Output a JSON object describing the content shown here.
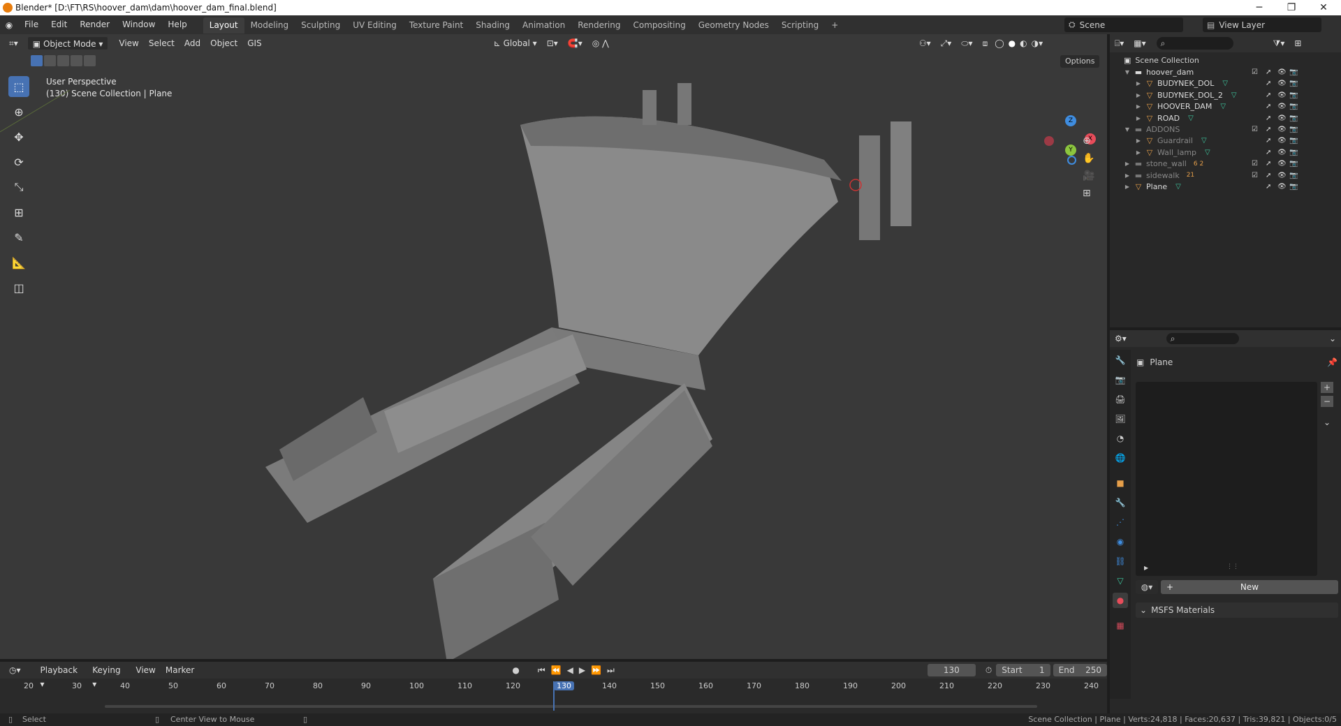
{
  "window": {
    "title": "Blender* [D:\\FT\\RS\\hoover_dam\\dam\\hoover_dam_final.blend]",
    "minimize": "─",
    "maximize": "❐",
    "close": "✕"
  },
  "menus": [
    "File",
    "Edit",
    "Render",
    "Window",
    "Help"
  ],
  "workspaces": [
    "Layout",
    "Modeling",
    "Sculpting",
    "UV Editing",
    "Texture Paint",
    "Shading",
    "Animation",
    "Rendering",
    "Compositing",
    "Geometry Nodes",
    "Scripting"
  ],
  "workspace_add": "+",
  "scene": {
    "label": "Scene",
    "view_layer": "View Layer"
  },
  "viewport_header": {
    "mode": "Object Mode",
    "menus": [
      "View",
      "Select",
      "Add",
      "Object",
      "GIS"
    ],
    "orientation": "Global",
    "options": "Options"
  },
  "viewport": {
    "perspective": "User Perspective",
    "collection_info": "(130) Scene Collection | Plane",
    "gizmo": {
      "x": "X",
      "y": "Y",
      "z": "Z"
    }
  },
  "outliner": {
    "root": "Scene Collection",
    "rows": [
      {
        "label": "hoover_dam",
        "type": "collection",
        "indent": 1,
        "dim": false
      },
      {
        "label": "BUDYNEK_DOL",
        "type": "mesh",
        "indent": 2,
        "dim": false
      },
      {
        "label": "BUDYNEK_DOL_2",
        "type": "mesh",
        "indent": 2,
        "dim": false
      },
      {
        "label": "HOOVER_DAM",
        "type": "mesh",
        "indent": 2,
        "dim": false
      },
      {
        "label": "ROAD",
        "type": "mesh",
        "indent": 2,
        "dim": false
      },
      {
        "label": "ADDONS",
        "type": "collection",
        "indent": 1,
        "dim": true
      },
      {
        "label": "Guardrail",
        "type": "mesh",
        "indent": 2,
        "dim": true
      },
      {
        "label": "Wall_lamp",
        "type": "mesh",
        "indent": 2,
        "dim": true
      },
      {
        "label": "stone_wall",
        "type": "collection",
        "indent": 1,
        "dim": true,
        "badge": "6  2"
      },
      {
        "label": "sidewalk",
        "type": "collection",
        "indent": 1,
        "dim": true,
        "badge": "21"
      },
      {
        "label": "Plane",
        "type": "mesh",
        "indent": 1,
        "dim": false
      }
    ]
  },
  "properties": {
    "object_name": "Plane",
    "new_button": "New",
    "section": "MSFS Materials"
  },
  "timeline": {
    "menus": [
      "Playback",
      "Keying",
      "View",
      "Marker"
    ],
    "current_frame": "130",
    "start_label": "Start",
    "start": "1",
    "end_label": "End",
    "end": "250",
    "ticks": [
      "20",
      "30",
      "40",
      "50",
      "60",
      "70",
      "80",
      "90",
      "100",
      "110",
      "120",
      "130",
      "140",
      "150",
      "160",
      "170",
      "180",
      "190",
      "200",
      "210",
      "220",
      "230",
      "240"
    ]
  },
  "statusbar": {
    "select": "Select",
    "center": "Center View to Mouse",
    "stats": "Scene Collection | Plane | Verts:24,818 | Faces:20,637 | Tris:39,821 | Objects:0/5"
  },
  "colors": {
    "accent": "#4772b3",
    "mesh_icon": "#e69f4a",
    "vertex_icon": "#3ec9a0",
    "axis_x": "#e84c5a",
    "axis_y": "#8cc63e",
    "axis_z": "#3f8de0"
  }
}
